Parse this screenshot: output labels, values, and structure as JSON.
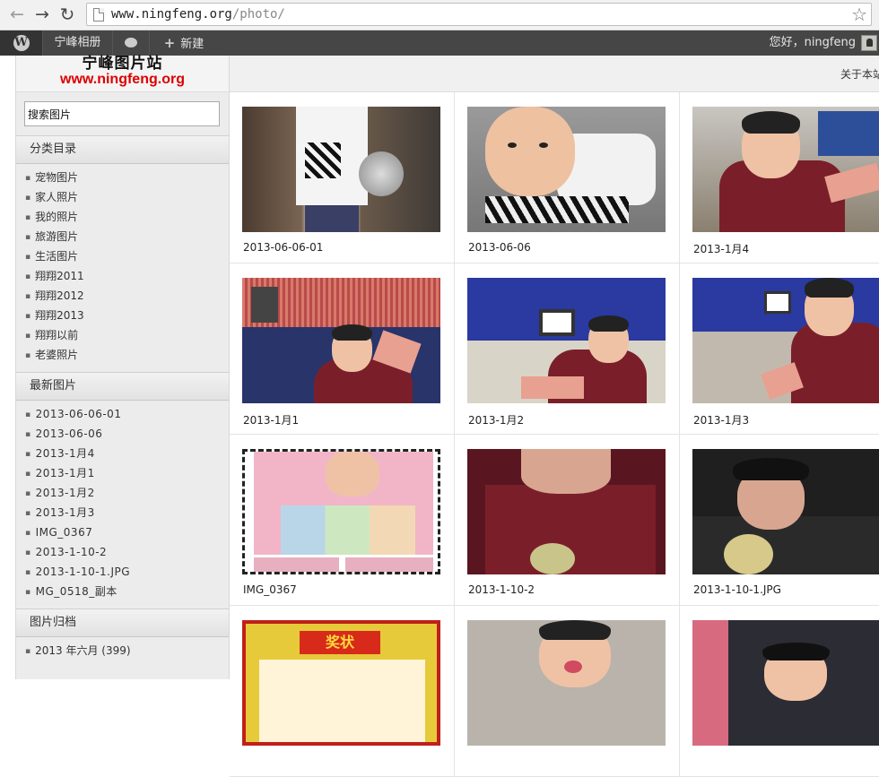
{
  "browser": {
    "url_domain": "www.ningfeng.org",
    "url_path": "/photo/"
  },
  "adminbar": {
    "site_name": "宁峰相册",
    "new_label": "新建",
    "greeting": "您好，ningfeng"
  },
  "sidebar": {
    "logo_title": "宁峰图片站",
    "logo_url": "www.ningfeng.org",
    "search_value": "搜索图片",
    "categories_title": "分类目录",
    "categories": [
      "宠物图片",
      "家人照片",
      "我的照片",
      "旅游图片",
      "生活图片",
      "翔翔2011",
      "翔翔2012",
      "翔翔2013",
      "翔翔以前",
      "老婆照片"
    ],
    "latest_title": "最新图片",
    "latest": [
      "2013-06-06-01",
      "2013-06-06",
      "2013-1月4",
      "2013-1月1",
      "2013-1月2",
      "2013-1月3",
      "IMG_0367",
      "2013-1-10-2",
      "2013-1-10-1.JPG",
      "MG_0518_副本"
    ],
    "archive_title": "图片归档",
    "archive": [
      "2013 年六月 (399)"
    ]
  },
  "main": {
    "about_link": "关于本站",
    "photos": [
      {
        "caption": "2013-06-06-01"
      },
      {
        "caption": "2013-06-06"
      },
      {
        "caption": "2013-1月4"
      },
      {
        "caption": "2013-1月1"
      },
      {
        "caption": "2013-1月2"
      },
      {
        "caption": "2013-1月3"
      },
      {
        "caption": "IMG_0367"
      },
      {
        "caption": "2013-1-10-2"
      },
      {
        "caption": "2013-1-10-1.JPG"
      },
      {
        "caption": ""
      },
      {
        "caption": ""
      },
      {
        "caption": ""
      }
    ],
    "award_text": "奖状"
  }
}
